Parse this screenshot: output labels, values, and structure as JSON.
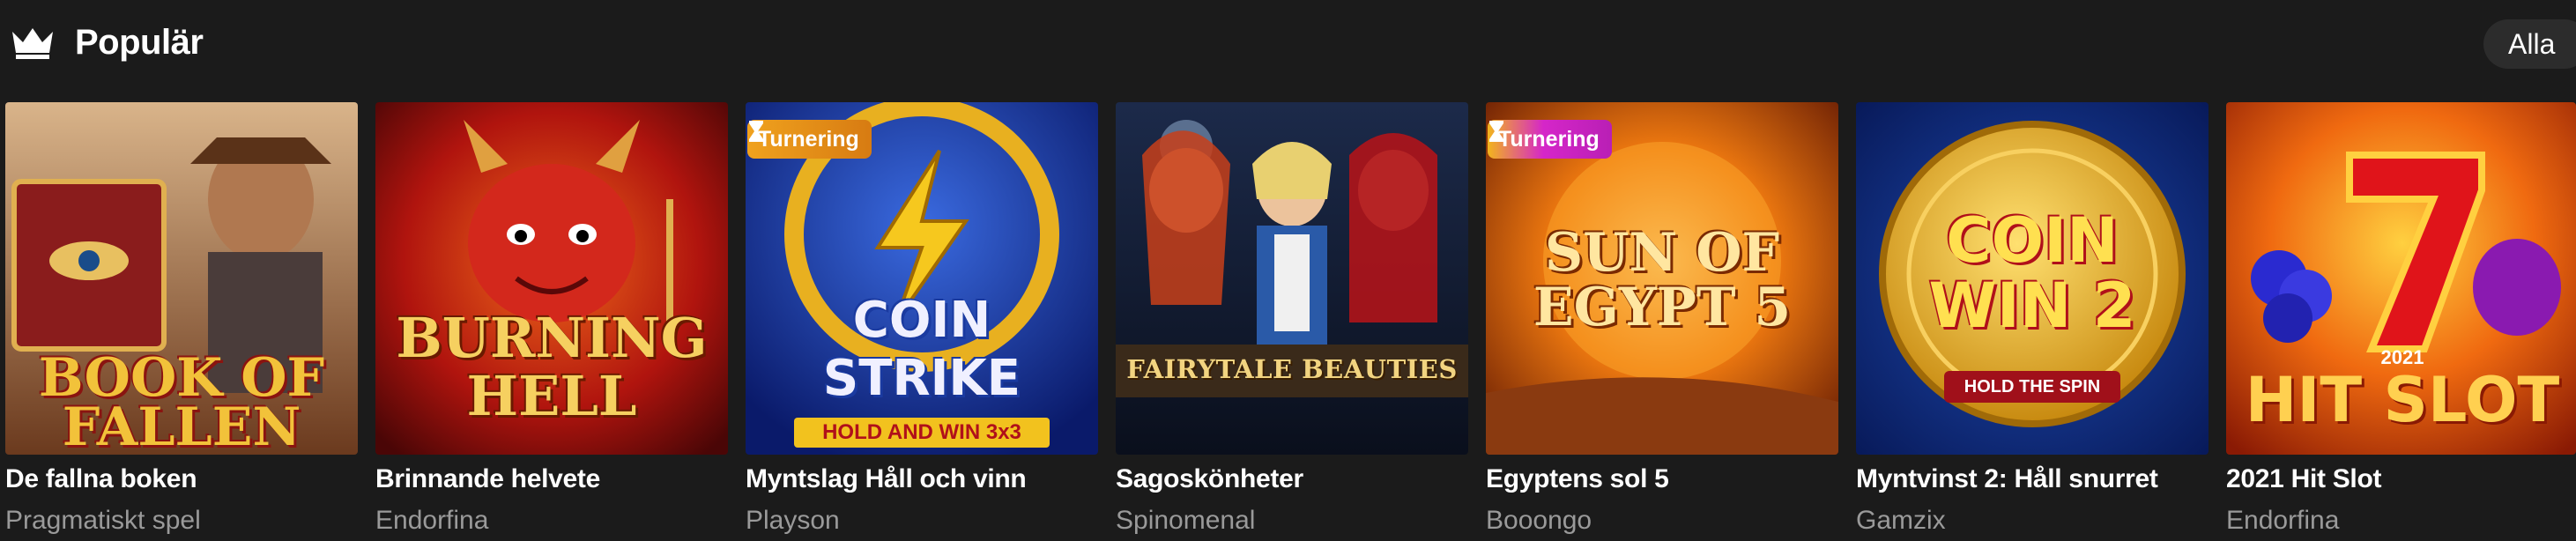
{
  "header": {
    "icon": "crown-icon",
    "title": "Populär",
    "all_label": "Alla"
  },
  "colors": {
    "background": "#1b1b1b",
    "provider_text": "#9a9a9a",
    "badge_orange": "#e8901a",
    "badge_magenta": "#d526c9"
  },
  "games": [
    {
      "title": "De fallna boken",
      "provider": "Pragmatiskt spel",
      "art_text": "BOOK OF FALLEN",
      "badge": ""
    },
    {
      "title": "Brinnande helvete",
      "provider": "Endorfina",
      "art_text": "BURNING HELL",
      "badge": ""
    },
    {
      "title": "Myntslag Håll och vinn",
      "provider": "Playson",
      "art_text": "COIN STRIKE",
      "art_sub": "HOLD AND WIN 3x3",
      "badge": "Turnering"
    },
    {
      "title": "Sagoskönheter",
      "provider": "Spinomenal",
      "art_text": "FAIRYTALE BEAUTIES",
      "badge": ""
    },
    {
      "title": "Egyptens sol 5",
      "provider": "Booongo",
      "art_text": "SUN OF EGYPT 5",
      "badge": "Turnering"
    },
    {
      "title": "Myntvinst 2: Håll snurret",
      "provider": "Gamzix",
      "art_text": "COIN WIN 2",
      "art_sub": "HOLD THE SPIN",
      "badge": ""
    },
    {
      "title": "2021 Hit Slot",
      "provider": "Endorfina",
      "art_text": "HIT SLOT",
      "art_sub": "2021",
      "badge": ""
    }
  ]
}
